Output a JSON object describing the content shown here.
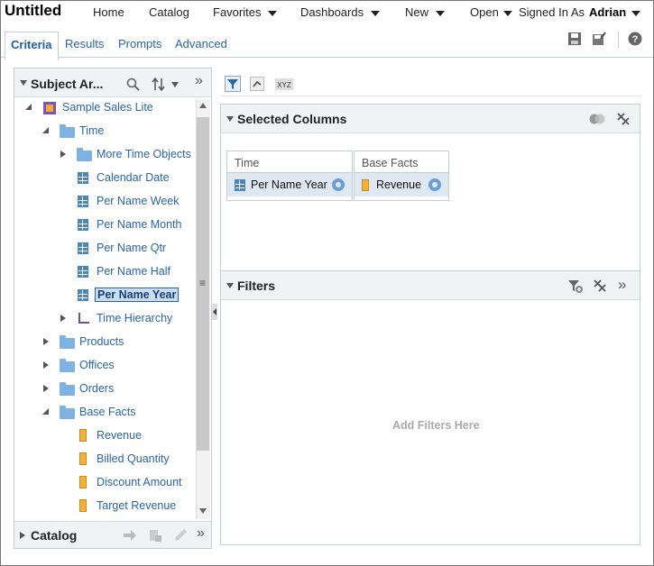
{
  "app": {
    "title": "Untitled"
  },
  "menu": {
    "home": "Home",
    "catalog": "Catalog",
    "favorites": "Favorites",
    "dashboards": "Dashboards",
    "new": "New",
    "open": "Open",
    "signed_in_as": "Signed In As",
    "user": "Adrian"
  },
  "tabs": [
    "Criteria",
    "Results",
    "Prompts",
    "Advanced"
  ],
  "left_panel": {
    "title": "Subject Ar...",
    "footer_title": "Catalog",
    "tree": [
      {
        "label": "Sample Sales Lite",
        "type": "subject-area",
        "level": 0,
        "expanded": true
      },
      {
        "label": "Time",
        "type": "folder",
        "level": 1,
        "expanded": true
      },
      {
        "label": "More Time Objects",
        "type": "folder",
        "level": 2,
        "expanded": false
      },
      {
        "label": "Calendar Date",
        "type": "column",
        "level": 2
      },
      {
        "label": "Per Name Week",
        "type": "column",
        "level": 2
      },
      {
        "label": "Per Name Month",
        "type": "column",
        "level": 2
      },
      {
        "label": "Per Name Qtr",
        "type": "column",
        "level": 2
      },
      {
        "label": "Per Name Half",
        "type": "column",
        "level": 2
      },
      {
        "label": "Per Name Year",
        "type": "column",
        "level": 2,
        "selected": true
      },
      {
        "label": "Time Hierarchy",
        "type": "hierarchy",
        "level": 2,
        "expanded": false
      },
      {
        "label": "Products",
        "type": "folder",
        "level": 1,
        "expanded": false
      },
      {
        "label": "Offices",
        "type": "folder",
        "level": 1,
        "expanded": false
      },
      {
        "label": "Orders",
        "type": "folder",
        "level": 1,
        "expanded": false
      },
      {
        "label": "Base Facts",
        "type": "folder",
        "level": 1,
        "expanded": true
      },
      {
        "label": "Revenue",
        "type": "measure",
        "level": 2
      },
      {
        "label": "Billed Quantity",
        "type": "measure",
        "level": 2
      },
      {
        "label": "Discount Amount",
        "type": "measure",
        "level": 2
      },
      {
        "label": "Target Revenue",
        "type": "measure",
        "level": 2
      }
    ]
  },
  "selected_columns": {
    "title": "Selected Columns",
    "groups": [
      {
        "header": "Time",
        "item": "Per Name Year"
      },
      {
        "header": "Base Facts",
        "item": "Revenue"
      }
    ]
  },
  "filters": {
    "title": "Filters",
    "empty_text": "Add Filters Here"
  },
  "toolbar_icons": {
    "xyz_label": "XYZ"
  },
  "colors": {
    "link": "#2a64a8",
    "panel_header": "#f0f2f4",
    "column_chip": "#dde8f3",
    "folder": "#7eb2e3",
    "measure": "#f2b03f"
  }
}
